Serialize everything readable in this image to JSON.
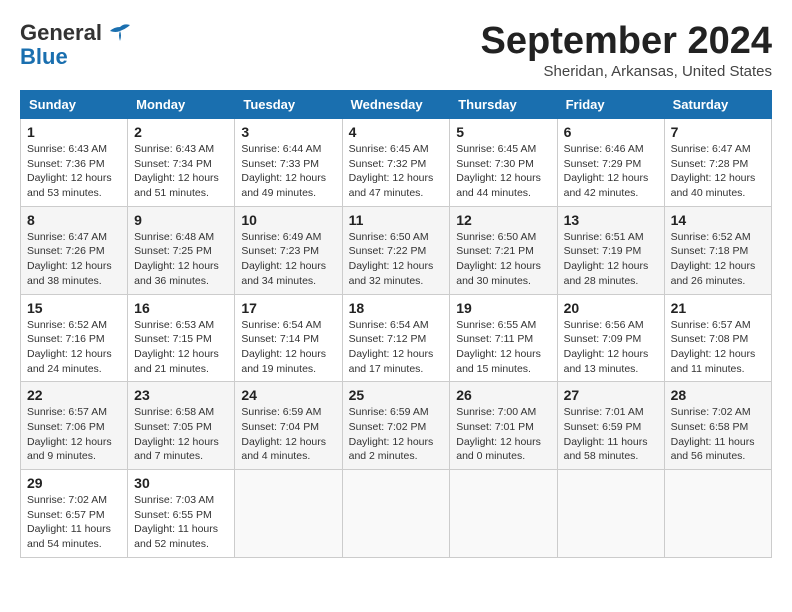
{
  "logo": {
    "line1": "General",
    "line2": "Blue"
  },
  "title": "September 2024",
  "location": "Sheridan, Arkansas, United States",
  "days_of_week": [
    "Sunday",
    "Monday",
    "Tuesday",
    "Wednesday",
    "Thursday",
    "Friday",
    "Saturday"
  ],
  "weeks": [
    [
      {
        "day": "1",
        "sunrise": "6:43 AM",
        "sunset": "7:36 PM",
        "daylight": "12 hours and 53 minutes."
      },
      {
        "day": "2",
        "sunrise": "6:43 AM",
        "sunset": "7:34 PM",
        "daylight": "12 hours and 51 minutes."
      },
      {
        "day": "3",
        "sunrise": "6:44 AM",
        "sunset": "7:33 PM",
        "daylight": "12 hours and 49 minutes."
      },
      {
        "day": "4",
        "sunrise": "6:45 AM",
        "sunset": "7:32 PM",
        "daylight": "12 hours and 47 minutes."
      },
      {
        "day": "5",
        "sunrise": "6:45 AM",
        "sunset": "7:30 PM",
        "daylight": "12 hours and 44 minutes."
      },
      {
        "day": "6",
        "sunrise": "6:46 AM",
        "sunset": "7:29 PM",
        "daylight": "12 hours and 42 minutes."
      },
      {
        "day": "7",
        "sunrise": "6:47 AM",
        "sunset": "7:28 PM",
        "daylight": "12 hours and 40 minutes."
      }
    ],
    [
      {
        "day": "8",
        "sunrise": "6:47 AM",
        "sunset": "7:26 PM",
        "daylight": "12 hours and 38 minutes."
      },
      {
        "day": "9",
        "sunrise": "6:48 AM",
        "sunset": "7:25 PM",
        "daylight": "12 hours and 36 minutes."
      },
      {
        "day": "10",
        "sunrise": "6:49 AM",
        "sunset": "7:23 PM",
        "daylight": "12 hours and 34 minutes."
      },
      {
        "day": "11",
        "sunrise": "6:50 AM",
        "sunset": "7:22 PM",
        "daylight": "12 hours and 32 minutes."
      },
      {
        "day": "12",
        "sunrise": "6:50 AM",
        "sunset": "7:21 PM",
        "daylight": "12 hours and 30 minutes."
      },
      {
        "day": "13",
        "sunrise": "6:51 AM",
        "sunset": "7:19 PM",
        "daylight": "12 hours and 28 minutes."
      },
      {
        "day": "14",
        "sunrise": "6:52 AM",
        "sunset": "7:18 PM",
        "daylight": "12 hours and 26 minutes."
      }
    ],
    [
      {
        "day": "15",
        "sunrise": "6:52 AM",
        "sunset": "7:16 PM",
        "daylight": "12 hours and 24 minutes."
      },
      {
        "day": "16",
        "sunrise": "6:53 AM",
        "sunset": "7:15 PM",
        "daylight": "12 hours and 21 minutes."
      },
      {
        "day": "17",
        "sunrise": "6:54 AM",
        "sunset": "7:14 PM",
        "daylight": "12 hours and 19 minutes."
      },
      {
        "day": "18",
        "sunrise": "6:54 AM",
        "sunset": "7:12 PM",
        "daylight": "12 hours and 17 minutes."
      },
      {
        "day": "19",
        "sunrise": "6:55 AM",
        "sunset": "7:11 PM",
        "daylight": "12 hours and 15 minutes."
      },
      {
        "day": "20",
        "sunrise": "6:56 AM",
        "sunset": "7:09 PM",
        "daylight": "12 hours and 13 minutes."
      },
      {
        "day": "21",
        "sunrise": "6:57 AM",
        "sunset": "7:08 PM",
        "daylight": "12 hours and 11 minutes."
      }
    ],
    [
      {
        "day": "22",
        "sunrise": "6:57 AM",
        "sunset": "7:06 PM",
        "daylight": "12 hours and 9 minutes."
      },
      {
        "day": "23",
        "sunrise": "6:58 AM",
        "sunset": "7:05 PM",
        "daylight": "12 hours and 7 minutes."
      },
      {
        "day": "24",
        "sunrise": "6:59 AM",
        "sunset": "7:04 PM",
        "daylight": "12 hours and 4 minutes."
      },
      {
        "day": "25",
        "sunrise": "6:59 AM",
        "sunset": "7:02 PM",
        "daylight": "12 hours and 2 minutes."
      },
      {
        "day": "26",
        "sunrise": "7:00 AM",
        "sunset": "7:01 PM",
        "daylight": "12 hours and 0 minutes."
      },
      {
        "day": "27",
        "sunrise": "7:01 AM",
        "sunset": "6:59 PM",
        "daylight": "11 hours and 58 minutes."
      },
      {
        "day": "28",
        "sunrise": "7:02 AM",
        "sunset": "6:58 PM",
        "daylight": "11 hours and 56 minutes."
      }
    ],
    [
      {
        "day": "29",
        "sunrise": "7:02 AM",
        "sunset": "6:57 PM",
        "daylight": "11 hours and 54 minutes."
      },
      {
        "day": "30",
        "sunrise": "7:03 AM",
        "sunset": "6:55 PM",
        "daylight": "11 hours and 52 minutes."
      },
      null,
      null,
      null,
      null,
      null
    ]
  ]
}
